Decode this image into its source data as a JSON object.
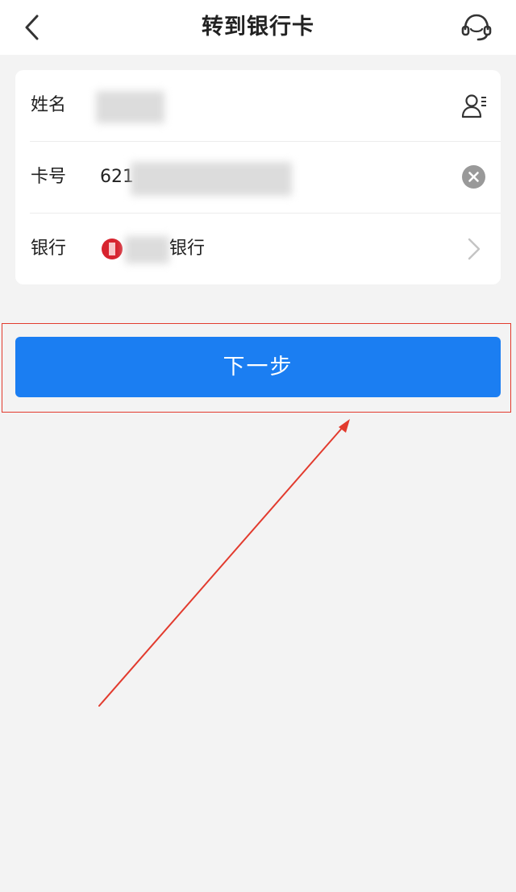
{
  "header": {
    "title": "转到银行卡",
    "back_icon": "chevron-left-icon",
    "service_icon": "headset-icon"
  },
  "form": {
    "name": {
      "label": "姓名",
      "value": "",
      "action_icon": "contact-card-icon"
    },
    "card_number": {
      "label": "卡号",
      "value": "621",
      "action_icon": "clear-icon"
    },
    "bank": {
      "label": "银行",
      "value": "银行",
      "logo_icon": "bank-logo-icon",
      "action_icon": "chevron-right-icon"
    }
  },
  "actions": {
    "next_label": "下一步"
  },
  "colors": {
    "primary": "#1b7ef2",
    "annotation": "#e23b2e",
    "background": "#f3f3f3"
  }
}
